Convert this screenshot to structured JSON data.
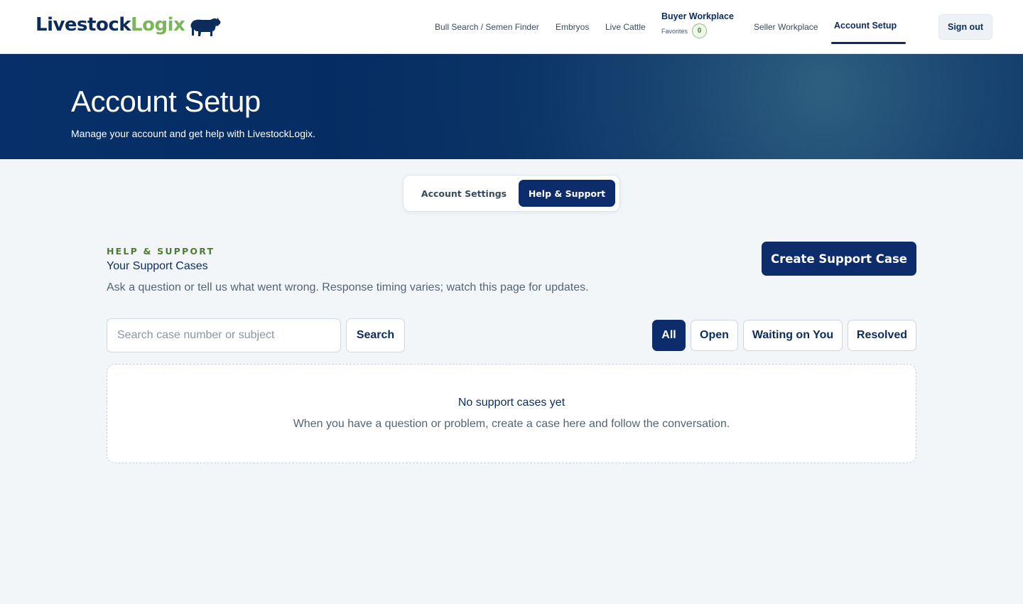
{
  "header": {
    "logo_part1": "Livestock",
    "logo_part2": "Logix",
    "logo_icon": "bull-icon",
    "nav": {
      "bull_search": "Bull Search / Semen Finder",
      "embryos": "Embryos",
      "live_cattle": "Live Cattle",
      "buyer_workplace": "Buyer Workplace",
      "favorites_label": "Favorites",
      "favorites_count": "0",
      "seller_workplace": "Seller Workplace",
      "account_setup": "Account Setup"
    },
    "sign_out": "Sign out"
  },
  "hero": {
    "title": "Account Setup",
    "subtitle": "Manage your account and get help with LivestockLogix."
  },
  "tabs": {
    "account_settings": "Account Settings",
    "help_support": "Help & Support",
    "active": "help_support"
  },
  "support": {
    "eyebrow": "HELP & SUPPORT",
    "title": "Your Support Cases",
    "description": "Ask a question or tell us what went wrong. Response timing varies; watch this page for updates.",
    "create_button": "Create Support Case",
    "search_placeholder": "Search case number or subject",
    "search_value": "",
    "search_button": "Search",
    "filters": {
      "all": "All",
      "open": "Open",
      "waiting": "Waiting on You",
      "resolved": "Resolved",
      "active": "all"
    },
    "empty_title": "No support cases yet",
    "empty_description": "When you have a question or problem, create a case here and follow the conversation."
  },
  "colors": {
    "brand_navy": "#0c2c6c",
    "brand_green": "#7ab65a",
    "eyebrow_green": "#4d7d2e",
    "hero_bg": "#062d63",
    "page_bg": "#f3f6f9"
  }
}
